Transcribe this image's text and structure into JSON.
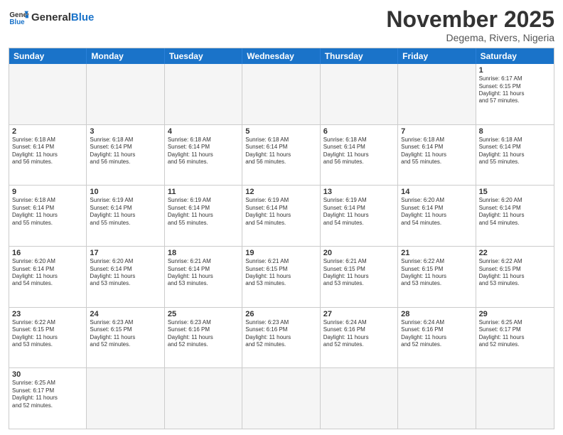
{
  "header": {
    "logo": "GeneralBlue",
    "title": "November 2025",
    "subtitle": "Degema, Rivers, Nigeria"
  },
  "weekdays": [
    "Sunday",
    "Monday",
    "Tuesday",
    "Wednesday",
    "Thursday",
    "Friday",
    "Saturday"
  ],
  "rows": [
    [
      {
        "day": "",
        "text": ""
      },
      {
        "day": "",
        "text": ""
      },
      {
        "day": "",
        "text": ""
      },
      {
        "day": "",
        "text": ""
      },
      {
        "day": "",
        "text": ""
      },
      {
        "day": "",
        "text": ""
      },
      {
        "day": "1",
        "text": "Sunrise: 6:17 AM\nSunset: 6:15 PM\nDaylight: 11 hours\nand 57 minutes."
      }
    ],
    [
      {
        "day": "2",
        "text": "Sunrise: 6:18 AM\nSunset: 6:14 PM\nDaylight: 11 hours\nand 56 minutes."
      },
      {
        "day": "3",
        "text": "Sunrise: 6:18 AM\nSunset: 6:14 PM\nDaylight: 11 hours\nand 56 minutes."
      },
      {
        "day": "4",
        "text": "Sunrise: 6:18 AM\nSunset: 6:14 PM\nDaylight: 11 hours\nand 56 minutes."
      },
      {
        "day": "5",
        "text": "Sunrise: 6:18 AM\nSunset: 6:14 PM\nDaylight: 11 hours\nand 56 minutes."
      },
      {
        "day": "6",
        "text": "Sunrise: 6:18 AM\nSunset: 6:14 PM\nDaylight: 11 hours\nand 56 minutes."
      },
      {
        "day": "7",
        "text": "Sunrise: 6:18 AM\nSunset: 6:14 PM\nDaylight: 11 hours\nand 55 minutes."
      },
      {
        "day": "8",
        "text": "Sunrise: 6:18 AM\nSunset: 6:14 PM\nDaylight: 11 hours\nand 55 minutes."
      }
    ],
    [
      {
        "day": "9",
        "text": "Sunrise: 6:18 AM\nSunset: 6:14 PM\nDaylight: 11 hours\nand 55 minutes."
      },
      {
        "day": "10",
        "text": "Sunrise: 6:19 AM\nSunset: 6:14 PM\nDaylight: 11 hours\nand 55 minutes."
      },
      {
        "day": "11",
        "text": "Sunrise: 6:19 AM\nSunset: 6:14 PM\nDaylight: 11 hours\nand 55 minutes."
      },
      {
        "day": "12",
        "text": "Sunrise: 6:19 AM\nSunset: 6:14 PM\nDaylight: 11 hours\nand 54 minutes."
      },
      {
        "day": "13",
        "text": "Sunrise: 6:19 AM\nSunset: 6:14 PM\nDaylight: 11 hours\nand 54 minutes."
      },
      {
        "day": "14",
        "text": "Sunrise: 6:20 AM\nSunset: 6:14 PM\nDaylight: 11 hours\nand 54 minutes."
      },
      {
        "day": "15",
        "text": "Sunrise: 6:20 AM\nSunset: 6:14 PM\nDaylight: 11 hours\nand 54 minutes."
      }
    ],
    [
      {
        "day": "16",
        "text": "Sunrise: 6:20 AM\nSunset: 6:14 PM\nDaylight: 11 hours\nand 54 minutes."
      },
      {
        "day": "17",
        "text": "Sunrise: 6:20 AM\nSunset: 6:14 PM\nDaylight: 11 hours\nand 53 minutes."
      },
      {
        "day": "18",
        "text": "Sunrise: 6:21 AM\nSunset: 6:14 PM\nDaylight: 11 hours\nand 53 minutes."
      },
      {
        "day": "19",
        "text": "Sunrise: 6:21 AM\nSunset: 6:15 PM\nDaylight: 11 hours\nand 53 minutes."
      },
      {
        "day": "20",
        "text": "Sunrise: 6:21 AM\nSunset: 6:15 PM\nDaylight: 11 hours\nand 53 minutes."
      },
      {
        "day": "21",
        "text": "Sunrise: 6:22 AM\nSunset: 6:15 PM\nDaylight: 11 hours\nand 53 minutes."
      },
      {
        "day": "22",
        "text": "Sunrise: 6:22 AM\nSunset: 6:15 PM\nDaylight: 11 hours\nand 53 minutes."
      }
    ],
    [
      {
        "day": "23",
        "text": "Sunrise: 6:22 AM\nSunset: 6:15 PM\nDaylight: 11 hours\nand 53 minutes."
      },
      {
        "day": "24",
        "text": "Sunrise: 6:23 AM\nSunset: 6:15 PM\nDaylight: 11 hours\nand 52 minutes."
      },
      {
        "day": "25",
        "text": "Sunrise: 6:23 AM\nSunset: 6:16 PM\nDaylight: 11 hours\nand 52 minutes."
      },
      {
        "day": "26",
        "text": "Sunrise: 6:23 AM\nSunset: 6:16 PM\nDaylight: 11 hours\nand 52 minutes."
      },
      {
        "day": "27",
        "text": "Sunrise: 6:24 AM\nSunset: 6:16 PM\nDaylight: 11 hours\nand 52 minutes."
      },
      {
        "day": "28",
        "text": "Sunrise: 6:24 AM\nSunset: 6:16 PM\nDaylight: 11 hours\nand 52 minutes."
      },
      {
        "day": "29",
        "text": "Sunrise: 6:25 AM\nSunset: 6:17 PM\nDaylight: 11 hours\nand 52 minutes."
      }
    ],
    [
      {
        "day": "30",
        "text": "Sunrise: 6:25 AM\nSunset: 6:17 PM\nDaylight: 11 hours\nand 52 minutes."
      },
      {
        "day": "",
        "text": ""
      },
      {
        "day": "",
        "text": ""
      },
      {
        "day": "",
        "text": ""
      },
      {
        "day": "",
        "text": ""
      },
      {
        "day": "",
        "text": ""
      },
      {
        "day": "",
        "text": ""
      }
    ]
  ]
}
